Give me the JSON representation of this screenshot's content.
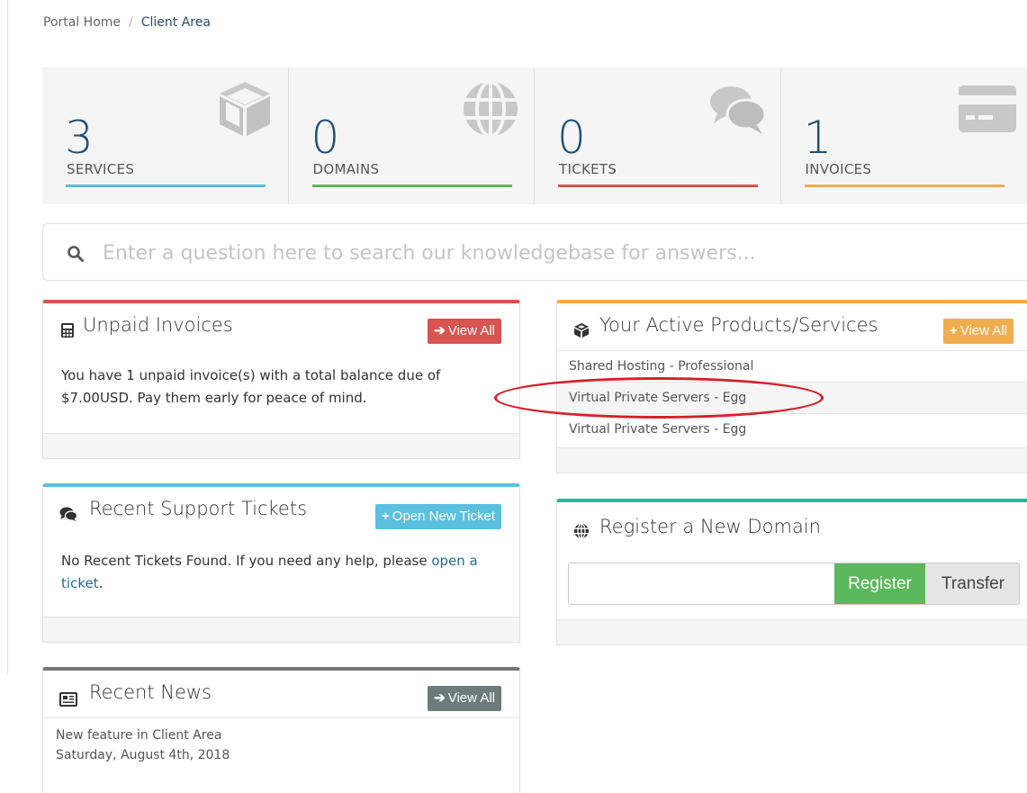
{
  "breadcrumb": {
    "home": "Portal Home",
    "separator": "/",
    "current": "Client Area"
  },
  "stats": [
    {
      "number": "3",
      "label": "SERVICES",
      "color": "#5bc0de",
      "icon": "cube-icon"
    },
    {
      "number": "0",
      "label": "DOMAINS",
      "color": "#5cb85c",
      "icon": "globe-icon"
    },
    {
      "number": "0",
      "label": "TICKETS",
      "color": "#d9534f",
      "icon": "comments-icon"
    },
    {
      "number": "1",
      "label": "INVOICES",
      "color": "#f0ad4e",
      "icon": "credit-card-icon"
    }
  ],
  "search": {
    "placeholder": "Enter a question here to search our knowledgebase for answers..."
  },
  "invoices_panel": {
    "title": "Unpaid Invoices",
    "button": "View All",
    "text_line1": "You have 1 unpaid invoice(s) with a total balance due of",
    "text_line2": "$7.00USD. Pay them early for peace of mind.",
    "accent": "#d9534f"
  },
  "tickets_panel": {
    "title": "Recent Support Tickets",
    "button": "Open New Ticket",
    "text_line1_pre": "No Recent Tickets Found. If you need any help, please ",
    "text_line1_link": "open a",
    "text_line2_link": "ticket",
    "text_line2_post": ".",
    "accent": "#5bc0de"
  },
  "news_panel": {
    "title": "Recent News",
    "button": "View All",
    "item_title": "New feature in Client Area",
    "item_date": "Saturday, August 4th, 2018",
    "accent": "#777777"
  },
  "products_panel": {
    "title": "Your Active Products/Services",
    "button": "View All",
    "items": [
      "Shared Hosting - Professional",
      "Virtual Private Servers - Egg",
      "Virtual Private Servers - Egg"
    ],
    "accent": "#f0ad4e"
  },
  "domain_panel": {
    "title": "Register a New Domain",
    "register_label": "Register",
    "transfer_label": "Transfer",
    "accent": "#1abc9c"
  }
}
